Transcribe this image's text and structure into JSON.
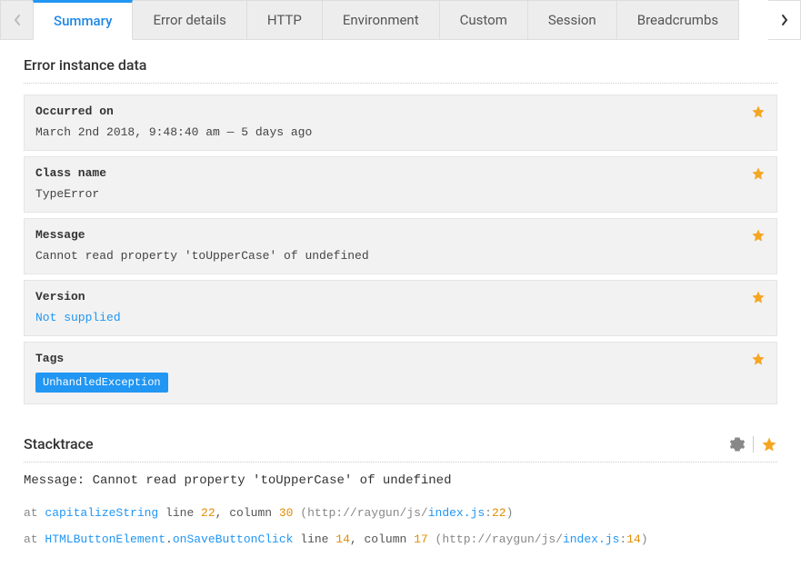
{
  "tabs": {
    "items": [
      {
        "label": "Summary"
      },
      {
        "label": "Error details"
      },
      {
        "label": "HTTP"
      },
      {
        "label": "Environment"
      },
      {
        "label": "Custom"
      },
      {
        "label": "Session"
      },
      {
        "label": "Breadcrumbs"
      }
    ],
    "active_index": 0
  },
  "section_instance_title": "Error instance data",
  "fields": {
    "occurred_on": {
      "label": "Occurred on",
      "value": "March 2nd 2018, 9:48:40 am — 5 days ago"
    },
    "class_name": {
      "label": "Class name",
      "value": "TypeError"
    },
    "message": {
      "label": "Message",
      "value": "Cannot read property 'toUpperCase' of undefined"
    },
    "version": {
      "label": "Version",
      "value": "Not supplied"
    },
    "tags": {
      "label": "Tags",
      "value": "UnhandledException"
    }
  },
  "stacktrace": {
    "title": "Stacktrace",
    "message_prefix": "Message: ",
    "message": "Cannot read property 'toUpperCase' of undefined",
    "frames": [
      {
        "at": "at ",
        "ident1": "capitalizeString",
        "sep_dot": "",
        "ident2": "",
        "line_word": " line ",
        "line": "22",
        "col_word": ", column ",
        "col": "30",
        "paren_open": " (",
        "url_prefix": "http://raygun/js/",
        "url_file": "index.js",
        "url_colon": ":",
        "url_line": "22",
        "paren_close": ")"
      },
      {
        "at": "at ",
        "ident1": "HTMLButtonElement",
        "sep_dot": ".",
        "ident2": "onSaveButtonClick",
        "line_word": " line ",
        "line": "14",
        "col_word": ", column ",
        "col": "17",
        "paren_open": " (",
        "url_prefix": "http://raygun/js/",
        "url_file": "index.js",
        "url_colon": ":",
        "url_line": "14",
        "paren_close": ")"
      }
    ]
  },
  "colors": {
    "accent": "#2196f3",
    "star": "#f5a623"
  }
}
